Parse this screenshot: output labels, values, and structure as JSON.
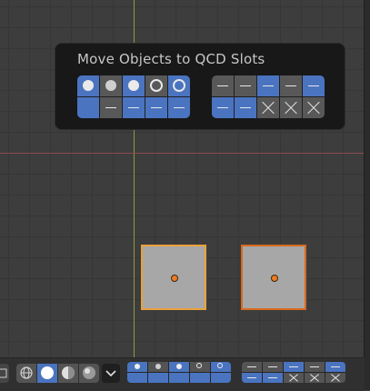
{
  "popup": {
    "title": "Move Objects to QCD Slots",
    "slots_left": {
      "row1": [
        "dot-full",
        "dot-dim",
        "dot-full",
        "ring",
        "ring"
      ],
      "row1_on": [
        true,
        false,
        true,
        false,
        true
      ],
      "row2": [
        "empty",
        "dash",
        "dash",
        "dash",
        "dash"
      ],
      "row2_on": [
        true,
        false,
        true,
        true,
        true
      ]
    },
    "slots_right": {
      "row1": [
        "dash",
        "dash",
        "dash",
        "dash",
        "dash"
      ],
      "row1_on": [
        false,
        false,
        true,
        false,
        true
      ],
      "row2": [
        "dash",
        "dash",
        "x",
        "x",
        "x"
      ],
      "row2_on": [
        true,
        true,
        false,
        false,
        false
      ]
    }
  },
  "viewport": {
    "objects": [
      {
        "name": "selected-object",
        "state": "selected"
      },
      {
        "name": "active-object",
        "state": "active"
      }
    ]
  },
  "toolbar": {
    "shading_modes": [
      "wireframe",
      "solid",
      "material",
      "rendered"
    ],
    "active_shading": "solid",
    "dropdown_icon": "chevron-down-icon"
  },
  "colors": {
    "accent": "#4a74c0",
    "selected": "#e9a23b",
    "active": "#d86a1d",
    "background": "#3d3d3d"
  }
}
